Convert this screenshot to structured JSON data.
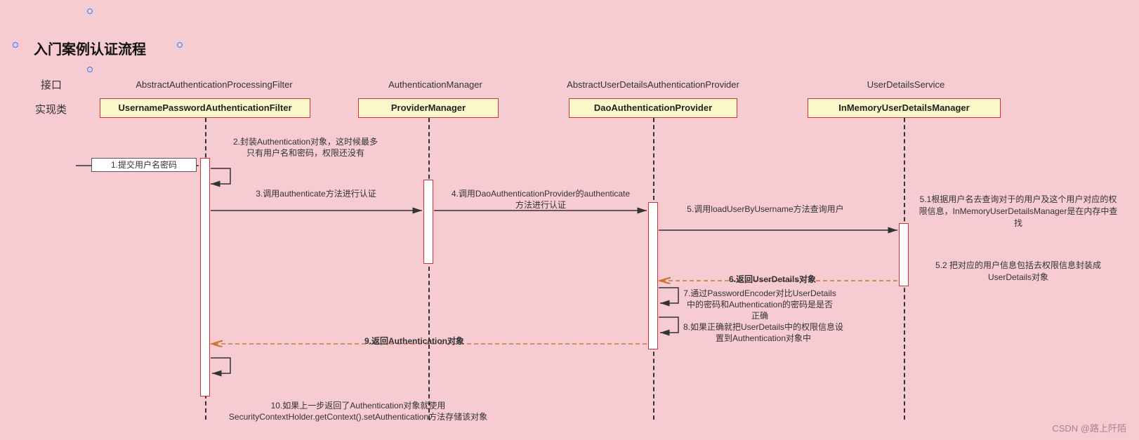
{
  "title": "入门案例认证流程",
  "sideLabels": {
    "interface": "接口",
    "impl": "实现类"
  },
  "columns": {
    "c1": {
      "interface": "AbstractAuthenticationProcessingFilter",
      "impl": "UsernamePasswordAuthenticationFilter"
    },
    "c2": {
      "interface": "AuthenticationManager",
      "impl": "ProviderManager"
    },
    "c3": {
      "interface": "AbstractUserDetailsAuthenticationProvider",
      "impl": "DaoAuthenticationProvider"
    },
    "c4": {
      "interface": "UserDetailsService",
      "impl": "InMemoryUserDetailsManager"
    }
  },
  "messages": {
    "m1": "1.提交用户名密码",
    "m2": "2.封装Authentication对象，这时候最多只有用户名和密码，权限还没有",
    "m3": "3.调用authenticate方法进行认证",
    "m4": "4.调用DaoAuthenticationProvider的authenticate方法进行认证",
    "m5": "5.调用loadUserByUsername方法查询用户",
    "m6": "6.返回UserDetails对象",
    "m7": "7.通过PasswordEncoder对比UserDetails中的密码和Authentication的密码是是否正确",
    "m8": "8.如果正确就把UserDetails中的权限信息设置到Authentication对象中",
    "m9": "9.返回Authentication对象",
    "m10": "10.如果上一步返回了Authentication对象就使用SecurityContextHolder.getContext().setAuthentication方法存储该对象"
  },
  "notes": {
    "n51": "5.1根据用户名去查询对于的用户及这个用户对应的权限信息，InMemoryUserDetailsManager是在内存中查找",
    "n52": "5.2 把对应的用户信息包括去权限信息封装成UserDetails对象"
  },
  "watermark": "CSDN @路上阡陌"
}
